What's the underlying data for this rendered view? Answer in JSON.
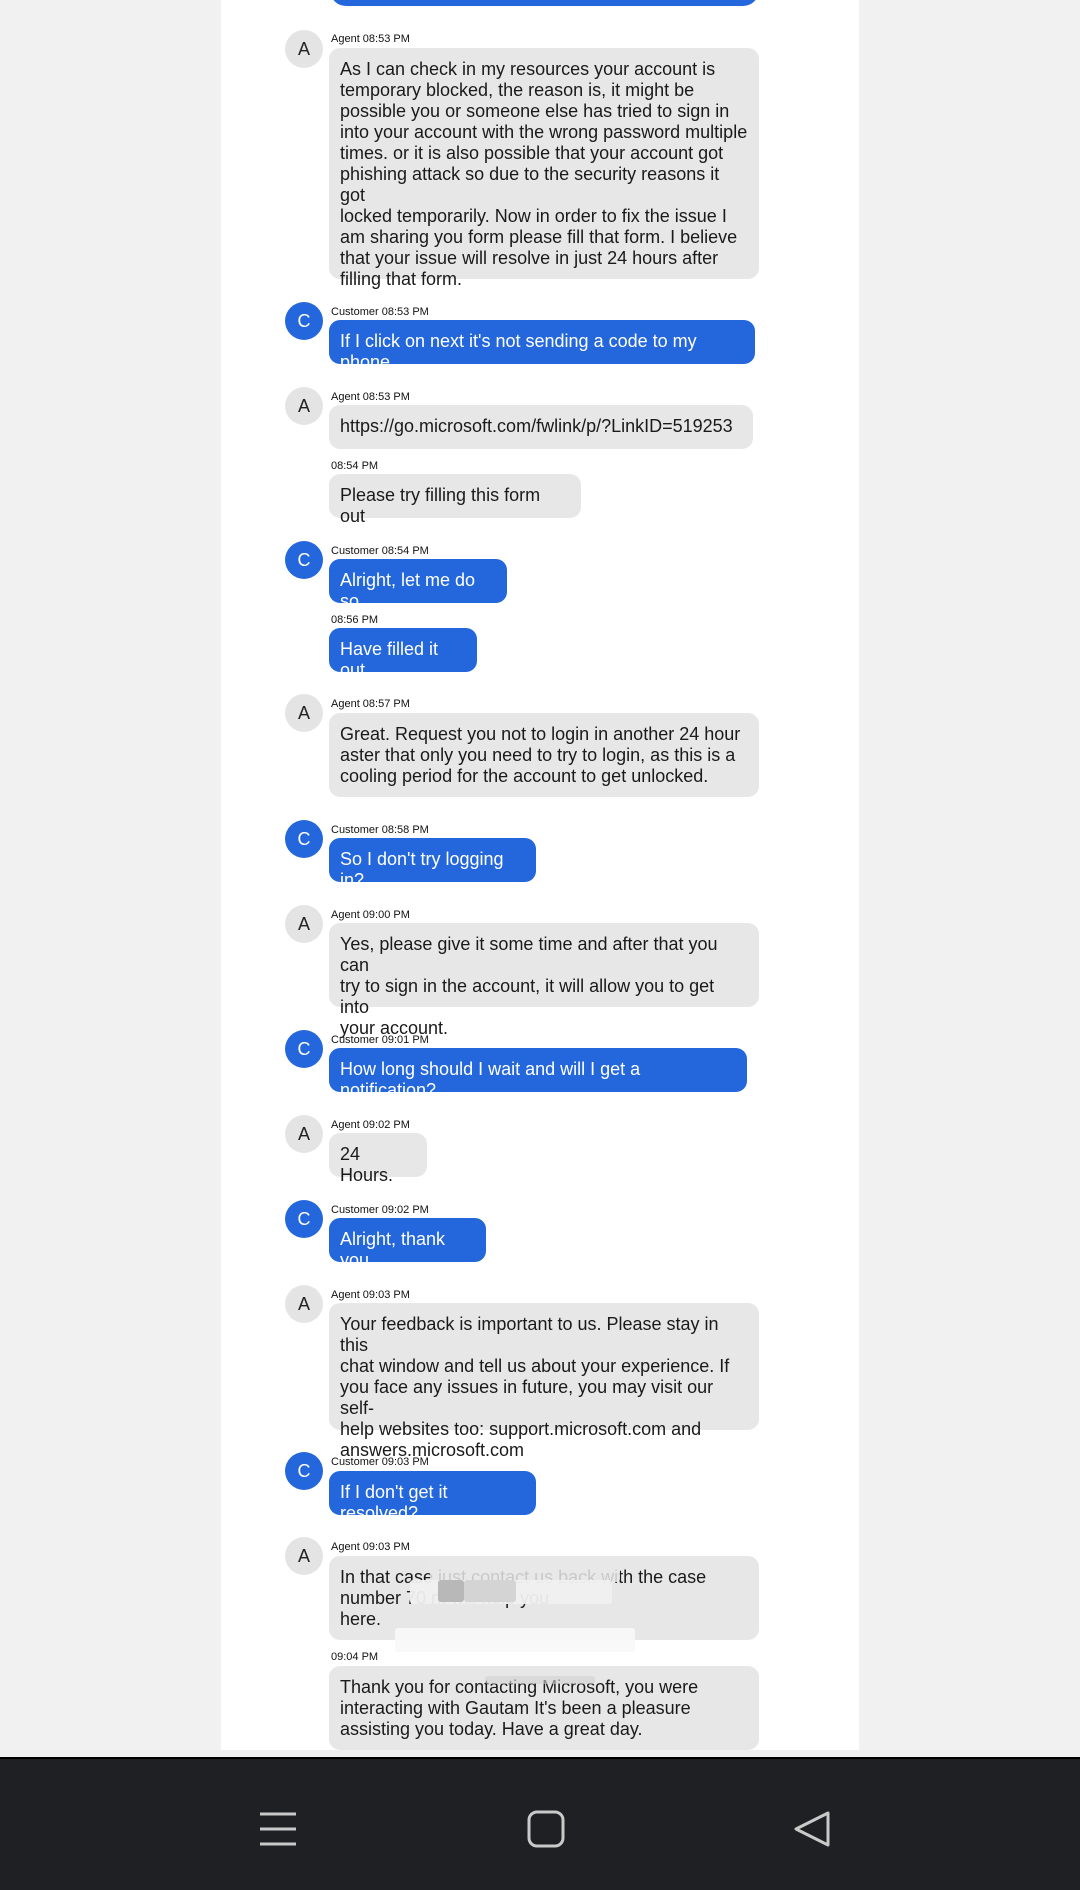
{
  "messages": [
    {
      "role": "agent",
      "avatar": "A",
      "meta": "Agent 08:53 PM",
      "text": "As I can check in my resources your account is\ntemporary blocked, the reason is, it might be\npossible you or someone else has tried to sign in\ninto your account with the wrong password multiple\ntimes. or it is also possible that your account got\nphishing attack so due to the security reasons it got\nlocked temporarily. Now in order to fix the issue I\nam sharing you form please fill that form. I believe\nthat your issue will resolve in just 24 hours after\nfilling that form."
    },
    {
      "role": "customer",
      "avatar": "C",
      "meta": "Customer 08:53 PM",
      "text": "If I click on next it's not sending a code to my phone"
    },
    {
      "role": "agent",
      "avatar": "A",
      "meta": "Agent 08:53 PM",
      "text": "https://go.microsoft.com/fwlink/p/?LinkID=519253"
    },
    {
      "role": "agent",
      "meta": "08:54 PM",
      "text": "Please try filling this form out"
    },
    {
      "role": "customer",
      "avatar": "C",
      "meta": "Customer 08:54 PM",
      "text": "Alright, let me do so"
    },
    {
      "role": "customer",
      "meta": "08:56 PM",
      "text": "Have filled it out"
    },
    {
      "role": "agent",
      "avatar": "A",
      "meta": "Agent 08:57 PM",
      "text": "Great. Request you not to login in another 24 hour\naster that only you need to try to login, as this is a\ncooling period for the account to get unlocked."
    },
    {
      "role": "customer",
      "avatar": "C",
      "meta": "Customer 08:58 PM",
      "text": "So I don't try logging in?"
    },
    {
      "role": "agent",
      "avatar": "A",
      "meta": "Agent 09:00 PM",
      "text": "Yes, please give it some time and after that you can\ntry to sign in the account, it will allow you to get into\nyour account."
    },
    {
      "role": "customer",
      "avatar": "C",
      "meta": "Customer 09:01 PM",
      "text": "How long should I wait and will I get a notification?"
    },
    {
      "role": "agent",
      "avatar": "A",
      "meta": "Agent 09:02 PM",
      "text": "24 Hours."
    },
    {
      "role": "customer",
      "avatar": "C",
      "meta": "Customer 09:02 PM",
      "text": "Alright, thank you"
    },
    {
      "role": "agent",
      "avatar": "A",
      "meta": "Agent 09:03 PM",
      "text": "Your feedback is important to us. Please stay in this\nchat window and tell us about your experience. If\nyou face any issues in future, you may visit our self-\nhelp websites too: support.microsoft.com and\nanswers.microsoft.com"
    },
    {
      "role": "customer",
      "avatar": "C",
      "meta": "Customer 09:03 PM",
      "text": "If I don't get it resolved?"
    },
    {
      "role": "agent",
      "avatar": "A",
      "meta": "Agent 09:03 PM",
      "text": "In that case just contact us back with the case\nnumber 70                                              nt will help you\nhere."
    },
    {
      "role": "agent",
      "meta": "09:04 PM",
      "text": "Thank you for contacting Microsoft, you were\ninteracting with Gautam It's been a pleasure\nassisting you today. Have a great day."
    }
  ],
  "navbar": {
    "menu_icon": "recent-apps-icon",
    "home_icon": "home-icon",
    "back_icon": "back-icon"
  },
  "colors": {
    "customer_bubble": "#2467dd",
    "agent_bubble": "#e7e7e7",
    "navbar": "#1f2023"
  }
}
